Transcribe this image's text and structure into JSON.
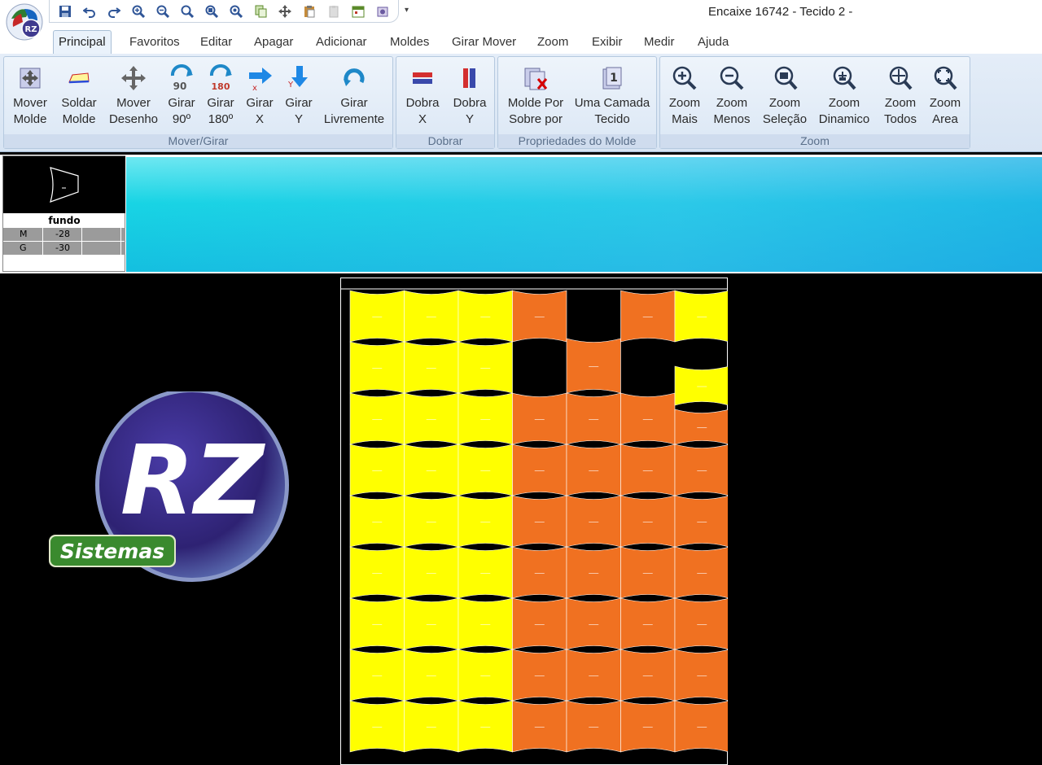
{
  "window": {
    "title": "Encaixe 16742 - Tecido 2 -"
  },
  "app_logo": {
    "text": "RZ"
  },
  "quick_access": {
    "items": [
      "save-icon",
      "undo-icon",
      "redo-icon",
      "zoom-in-icon",
      "zoom-out-icon",
      "zoom-fit-icon",
      "zoom-selection-icon",
      "zoom-all-icon",
      "copy-icon",
      "move-icon",
      "paste-icon",
      "clipboard-icon",
      "calendar-icon",
      "settings-icon"
    ],
    "dropdown": "▾"
  },
  "tabs": [
    "Principal",
    "Favoritos",
    "Editar",
    "Apagar",
    "Adicionar",
    "Moldes",
    "Girar Mover",
    "Zoom",
    "Exibir",
    "Medir",
    "Ajuda"
  ],
  "active_tab": "Principal",
  "ribbon": {
    "groups": {
      "mover_girar": {
        "label": "Mover/Girar",
        "buttons": [
          {
            "l1": "Mover",
            "l2": "Molde",
            "icon": "move-piece-icon"
          },
          {
            "l1": "Soldar",
            "l2": "Molde",
            "icon": "weld-piece-icon"
          },
          {
            "l1": "Mover",
            "l2": "Desenho",
            "icon": "move-drawing-icon"
          },
          {
            "l1": "Girar",
            "l2": "90º",
            "icon": "rotate-90-icon"
          },
          {
            "l1": "Girar",
            "l2": "180º",
            "icon": "rotate-180-icon"
          },
          {
            "l1": "Girar",
            "l2": "X",
            "icon": "flip-x-icon"
          },
          {
            "l1": "Girar",
            "l2": "Y",
            "icon": "flip-y-icon"
          },
          {
            "l1": "Girar",
            "l2": "Livremente",
            "icon": "rotate-free-icon"
          }
        ]
      },
      "dobrar": {
        "label": "Dobrar",
        "buttons": [
          {
            "l1": "Dobra",
            "l2": "X",
            "icon": "fold-x-icon"
          },
          {
            "l1": "Dobra",
            "l2": "Y",
            "icon": "fold-y-icon"
          }
        ]
      },
      "propriedades": {
        "label": "Propriedades do Molde",
        "buttons": [
          {
            "l1": "Molde Por",
            "l2": "Sobre por",
            "icon": "overlap-piece-icon"
          },
          {
            "l1": "Uma Camada",
            "l2": "Tecido",
            "icon": "single-layer-icon"
          }
        ]
      },
      "zoom": {
        "label": "Zoom",
        "buttons": [
          {
            "l1": "Zoom",
            "l2": "Mais",
            "icon": "zoom-in-icon"
          },
          {
            "l1": "Zoom",
            "l2": "Menos",
            "icon": "zoom-out-icon"
          },
          {
            "l1": "Zoom",
            "l2": "Seleção",
            "icon": "zoom-selection-icon"
          },
          {
            "l1": "Zoom",
            "l2": "Dinamico",
            "icon": "zoom-dynamic-icon"
          },
          {
            "l1": "Zoom",
            "l2": "Todos",
            "icon": "zoom-all-icon"
          },
          {
            "l1": "Zoom",
            "l2": "Area",
            "icon": "zoom-area-icon"
          }
        ]
      }
    }
  },
  "piece": {
    "name": "fundo",
    "sizes": [
      {
        "size": "M",
        "value": "-28"
      },
      {
        "size": "G",
        "value": "-30"
      }
    ]
  },
  "marker": {
    "colors": {
      "yellow": "#ffff00",
      "orange": "#f07121",
      "background": "#000000",
      "outline": "#ffffff"
    }
  },
  "logo": {
    "main": "RZ",
    "sub": "Sistemas"
  }
}
